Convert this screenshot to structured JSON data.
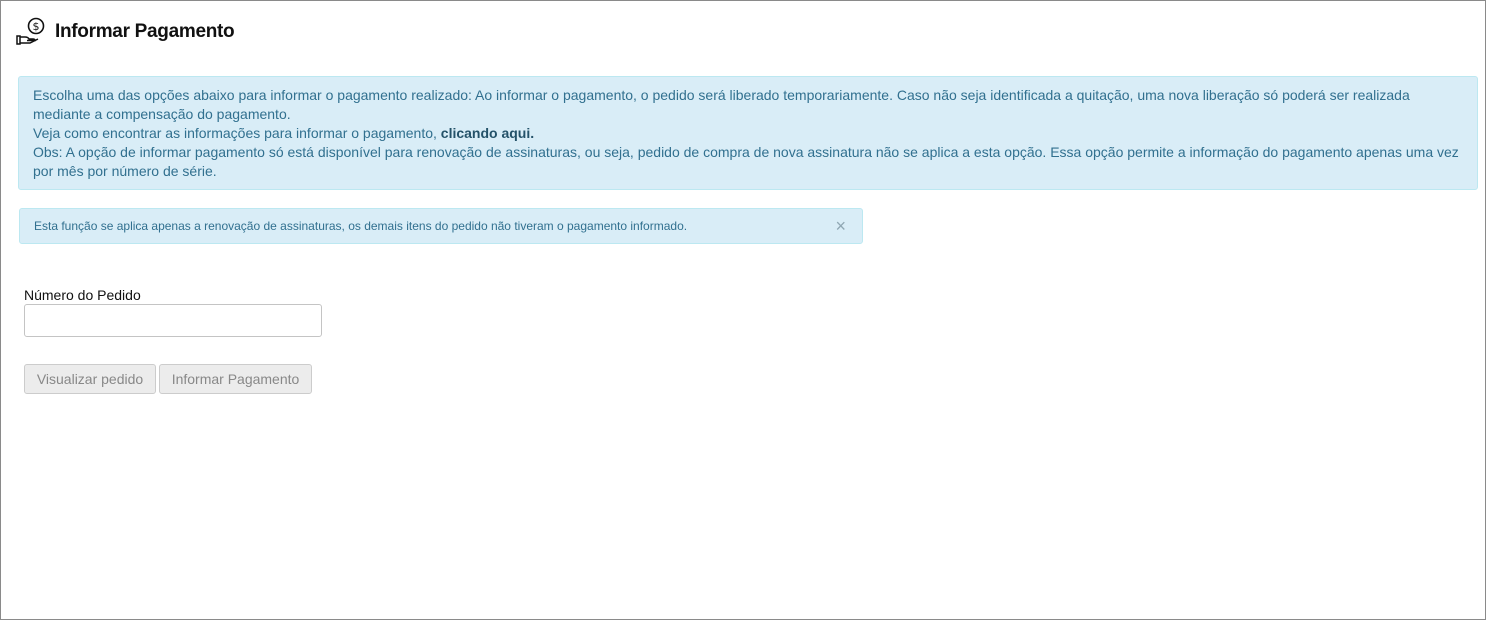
{
  "header": {
    "title": "Informar Pagamento",
    "icon": "hand-coin-icon"
  },
  "info_alert": {
    "line1": "Escolha uma das opções abaixo para informar o pagamento realizado: Ao informar o pagamento, o pedido será liberado temporariamente. Caso não seja identificada a quitação, uma nova liberação só poderá ser realizada mediante a compensação do pagamento.",
    "line2_prefix": "Veja como encontrar as informações para informar o pagamento, ",
    "line2_link": "clicando aqui.",
    "line3": "Obs: A opção de informar pagamento só está disponível para renovação de assinaturas, ou seja, pedido de compra de nova assinatura não se aplica a esta opção. Essa opção permite a informação do pagamento apenas uma vez por mês por número de série."
  },
  "notice_alert": {
    "text": "Esta função se aplica apenas a renovação de  assinaturas, os demais itens do pedido não tiveram o pagamento informado.",
    "close_label": "×"
  },
  "order_field": {
    "label": "Número do Pedido",
    "value": "",
    "placeholder": ""
  },
  "buttons": {
    "view_label": "Visualizar pedido",
    "pay_label": "Informar Pagamento"
  },
  "colors": {
    "alert_bg": "#d9edf7",
    "alert_text": "#31708f",
    "button_bg": "#ececec"
  }
}
